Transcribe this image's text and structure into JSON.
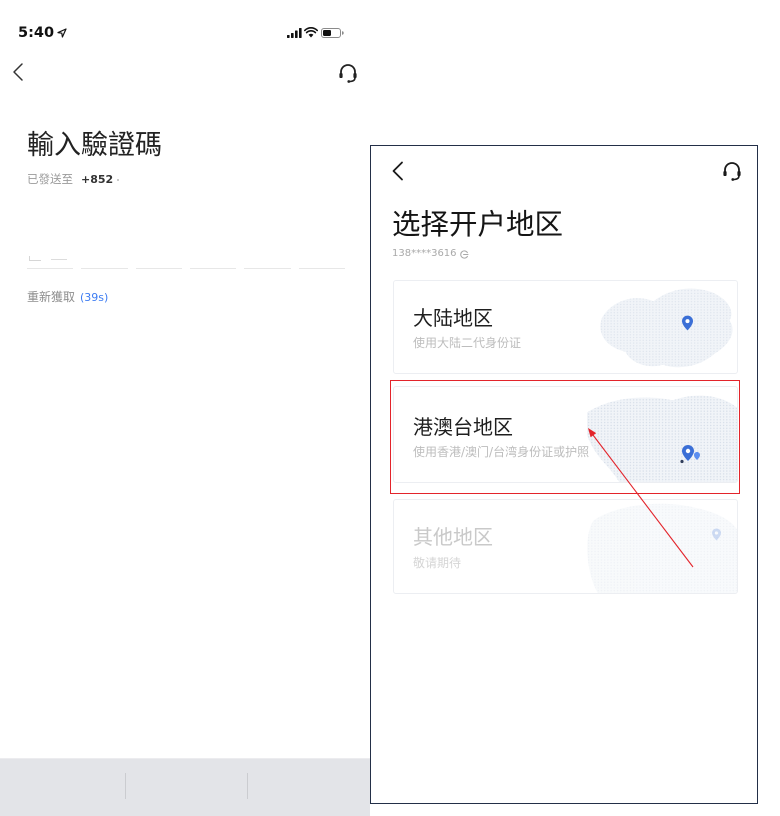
{
  "colors": {
    "accent": "#3d7cf2",
    "pin": "#3b6fd6",
    "annotation": "#e3242b",
    "frame_border": "#232f48",
    "disabled_text": "#c9c9c9"
  },
  "verification_screen": {
    "status_bar": {
      "time": "5:40",
      "battery_level": 0.5,
      "icons": [
        "location-arrow-icon",
        "signal-icon",
        "wifi-icon",
        "battery-icon"
      ]
    },
    "header": {
      "back_icon": "chevron-left-icon",
      "support_icon": "headset-icon"
    },
    "title": "輸入驗證碼",
    "sent_to": {
      "label": "已發送至",
      "phone_prefix": "+852"
    },
    "resend": {
      "label": "重新獲取",
      "countdown": "(39s)"
    }
  },
  "region_screen": {
    "header": {
      "back_icon": "chevron-left-icon",
      "support_icon": "headset-icon"
    },
    "title": "选择开户地区",
    "phone": "138****3616",
    "phone_icon": "phone-switch-icon",
    "regions": [
      {
        "name": "大陆地区",
        "description": "使用大陆二代身份证",
        "icon": "map-pin-icon",
        "disabled": false
      },
      {
        "name": "港澳台地区",
        "description": "使用香港/澳门/台湾身份证或护照",
        "icon": "map-pin-icon",
        "disabled": false
      },
      {
        "name": "其他地区",
        "description": "敬请期待",
        "icon": "map-pin-icon",
        "disabled": true
      }
    ]
  }
}
